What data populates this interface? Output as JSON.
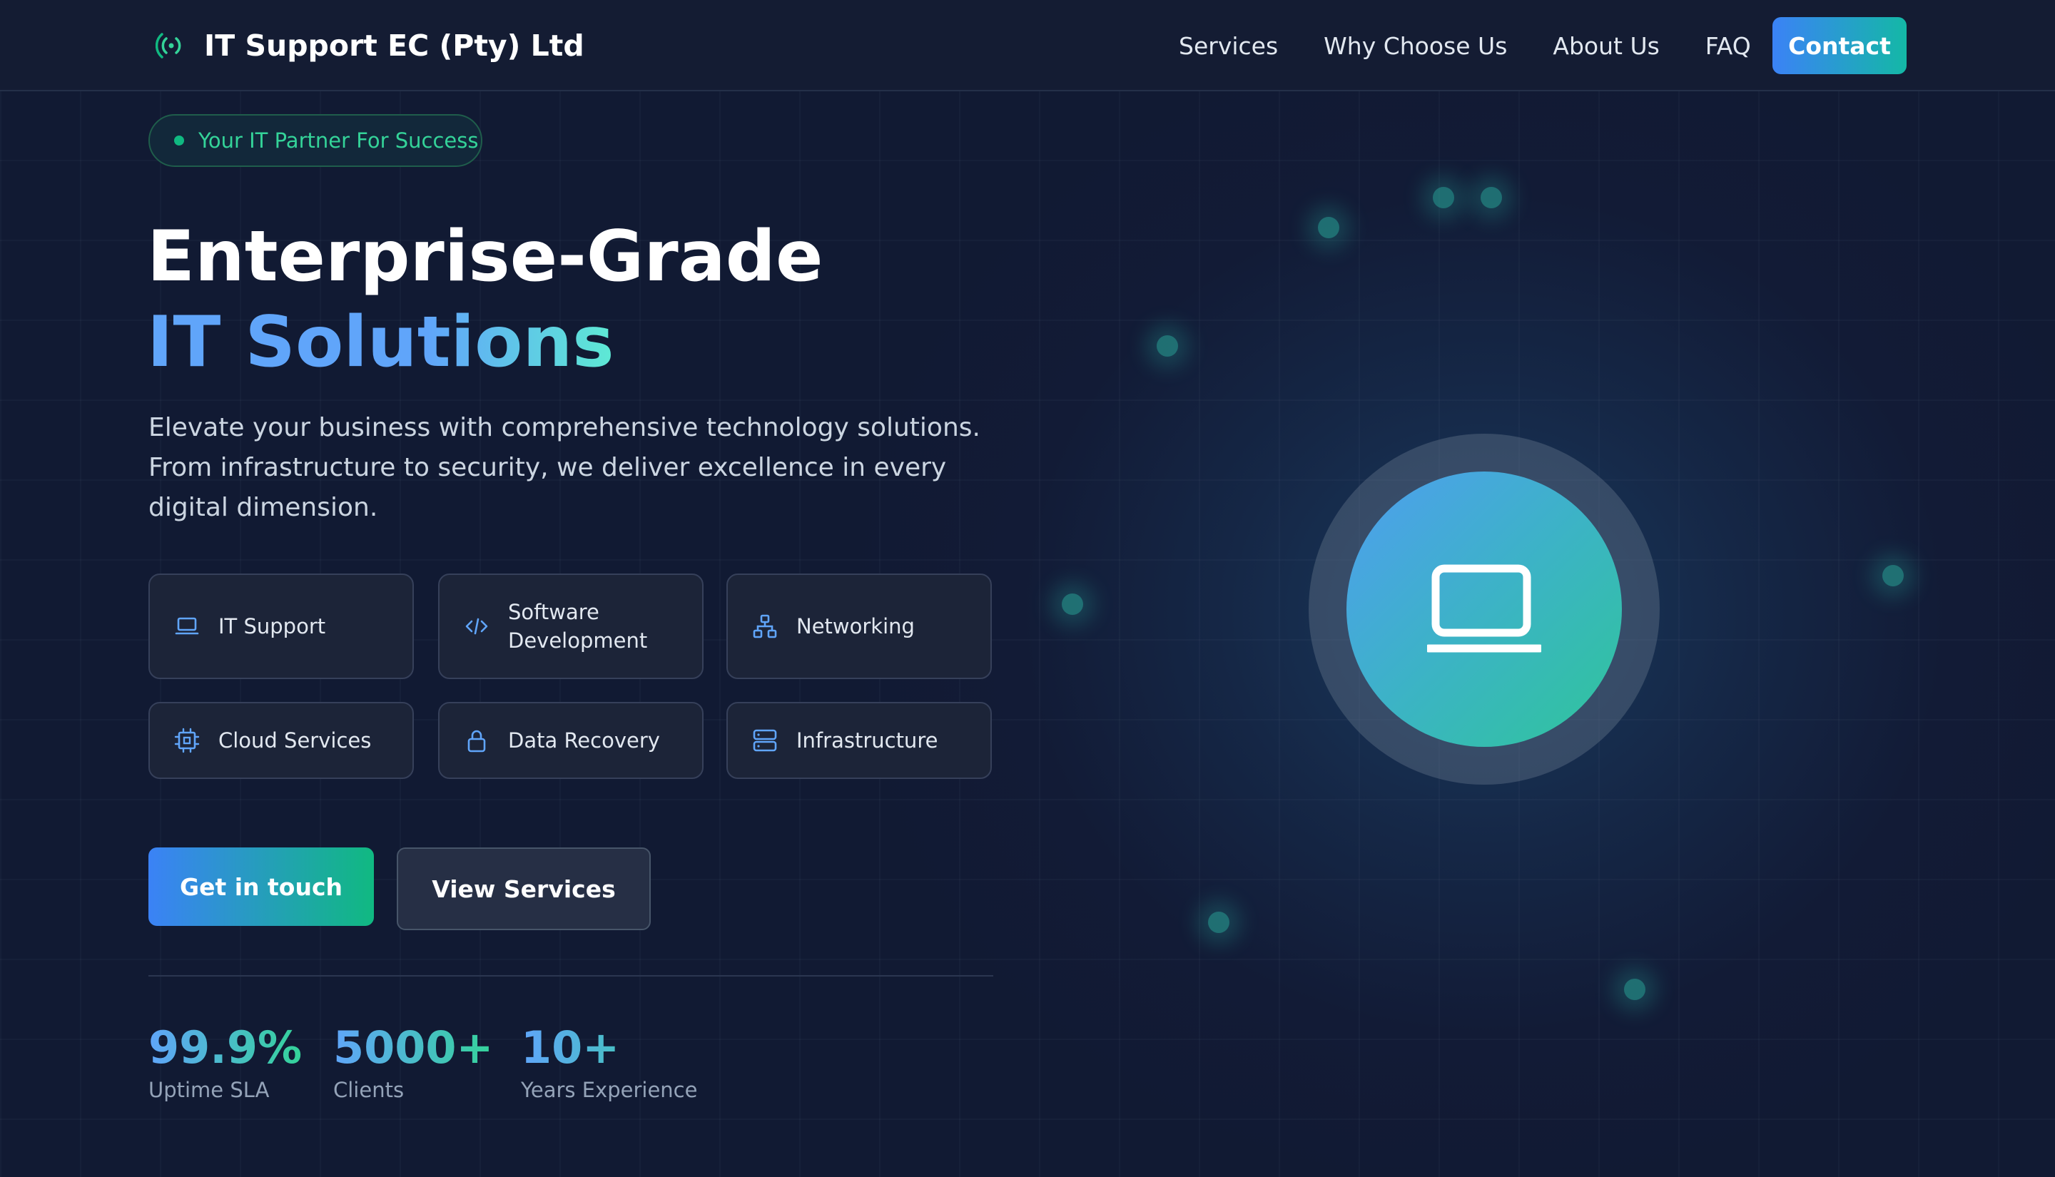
{
  "brand": {
    "name": "IT Support EC (Pty) Ltd"
  },
  "nav": {
    "links": [
      "Services",
      "Why Choose Us",
      "About Us",
      "FAQ"
    ],
    "contact": "Contact"
  },
  "hero": {
    "badge": "Your IT Partner For Success",
    "title_line1": "Enterprise-Grade",
    "title_line2": "IT Solutions",
    "description": "Elevate your business with comprehensive technology solutions. From infrastructure to security, we deliver excellence in every digital dimension.",
    "services": [
      {
        "label": "IT Support",
        "icon": "laptop-icon"
      },
      {
        "label": "Software Development",
        "icon": "code-icon"
      },
      {
        "label": "Networking",
        "icon": "network-icon"
      },
      {
        "label": "Cloud Services",
        "icon": "cpu-icon"
      },
      {
        "label": "Data Recovery",
        "icon": "lock-icon"
      },
      {
        "label": "Infrastructure",
        "icon": "server-icon"
      }
    ],
    "primary_button": "Get in touch",
    "secondary_button": "View Services",
    "stats": [
      {
        "value": "99.9%",
        "label": "Uptime SLA"
      },
      {
        "value": "5000+",
        "label": "Clients"
      },
      {
        "value": "10+",
        "label": "Years Experience"
      }
    ]
  },
  "visual": {
    "icon": "laptop-icon"
  },
  "colors": {
    "background": "#111a33",
    "accent_blue": "#3b82f6",
    "accent_green": "#10b981",
    "icon_blue": "#60a5fa"
  }
}
